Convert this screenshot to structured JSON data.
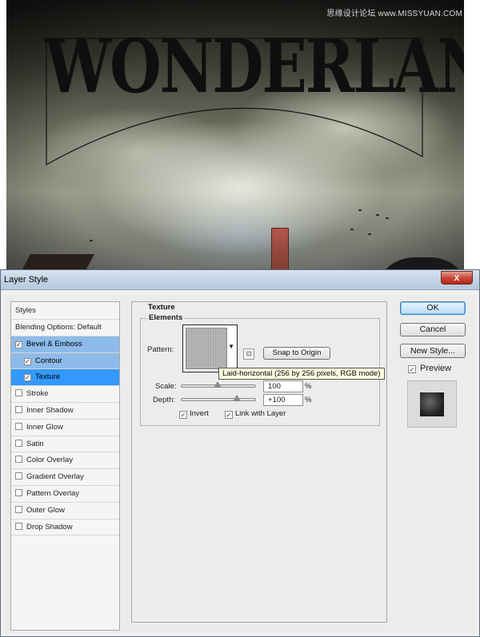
{
  "artwork": {
    "title_text": "WONDERLAND",
    "watermark": "思缘设计论坛 www.MISSYUAN.COM"
  },
  "dialog": {
    "title": "Layer Style",
    "close_glyph": "x"
  },
  "styles_list": {
    "header": "Styles",
    "items": [
      {
        "label": "Blending Options: Default",
        "checkbox": false,
        "checked": false
      },
      {
        "label": "Bevel & Emboss",
        "checkbox": true,
        "checked": true
      },
      {
        "label": "Contour",
        "checkbox": true,
        "checked": true
      },
      {
        "label": "Texture",
        "checkbox": true,
        "checked": true
      },
      {
        "label": "Stroke",
        "checkbox": true,
        "checked": false
      },
      {
        "label": "Inner Shadow",
        "checkbox": true,
        "checked": false
      },
      {
        "label": "Inner Glow",
        "checkbox": true,
        "checked": false
      },
      {
        "label": "Satin",
        "checkbox": true,
        "checked": false
      },
      {
        "label": "Color Overlay",
        "checkbox": true,
        "checked": false
      },
      {
        "label": "Gradient Overlay",
        "checkbox": true,
        "checked": false
      },
      {
        "label": "Pattern Overlay",
        "checkbox": true,
        "checked": false
      },
      {
        "label": "Outer Glow",
        "checkbox": true,
        "checked": false
      },
      {
        "label": "Drop Shadow",
        "checkbox": true,
        "checked": false
      }
    ]
  },
  "texture_panel": {
    "section_title": "Texture",
    "group_title": "Elements",
    "pattern_label": "Pattern:",
    "snap_button": "Snap to Origin",
    "tooltip": "Laid-horizontal (256 by 256 pixels, RGB mode)",
    "scale_label": "Scale:",
    "scale_value": "100",
    "scale_unit": "%",
    "depth_label": "Depth:",
    "depth_value": "+100",
    "depth_unit": "%",
    "invert_label": "Invert",
    "invert_checked": true,
    "link_label": "Link with Layer",
    "link_checked": true
  },
  "buttons": {
    "ok": "OK",
    "cancel": "Cancel",
    "new_style": "New Style...",
    "preview_label": "Preview",
    "preview_checked": true
  },
  "colors": {
    "selection_light": "#8dbbe9",
    "selection_active": "#3399ff",
    "ok_border": "#3c7fb1",
    "close_red": "#c8493a"
  }
}
